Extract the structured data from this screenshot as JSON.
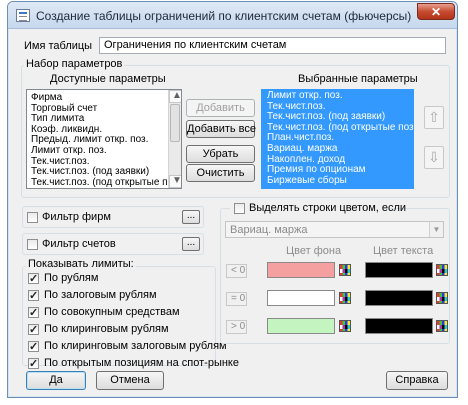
{
  "window": {
    "title": "Создание таблицы ограничений по клиентским счетам (фьючерсы)",
    "close_glyph": "✕"
  },
  "table_name": {
    "label": "Имя таблицы",
    "value": "Ограничения по клиентским счетам"
  },
  "params": {
    "group_label": "Набор параметров",
    "available_header": "Доступные параметры",
    "selected_header": "Выбранные параметры",
    "available": [
      "Фирма",
      "Торговый счет",
      "Тип лимита",
      "Коэф. ликвидн.",
      "Предыд. лимит откр. поз.",
      "Лимит откр. поз.",
      "Тек.чист.поз.",
      "Тек.чист.поз. (под заявки)",
      "Тек.чист.поз. (под открытые по"
    ],
    "selected": [
      "Лимит откр. поз.",
      "Тек.чист.поз.",
      "Тек.чист.поз. (под заявки)",
      "Тек.чист.поз. (под открытые поз",
      "План.чист.поз.",
      "Вариац. маржа",
      "Накоплен. доход",
      "Премия по опционам",
      "Биржевые сборы"
    ],
    "buttons": {
      "add": "Добавить",
      "add_all": "Добавить все",
      "remove": "Убрать",
      "clear": "Очистить"
    },
    "move_up_glyph": "⇧",
    "move_down_glyph": "⇩"
  },
  "filters": {
    "firms_label": "Фильтр фирм",
    "accounts_label": "Фильтр счетов",
    "dots": "..."
  },
  "limits": {
    "group_label": "Показывать лимиты:",
    "items": [
      {
        "label": "По рублям",
        "checked": true
      },
      {
        "label": "По залоговым рублям",
        "checked": true
      },
      {
        "label": "По совокупным средствам",
        "checked": true
      },
      {
        "label": "По клиринговым рублям",
        "checked": true
      },
      {
        "label": "По клиринговым залоговым рублям",
        "checked": true
      },
      {
        "label": "По открытым позициям на спот-рынке",
        "checked": true
      }
    ],
    "check_glyph": "✓"
  },
  "highlight": {
    "checkbox_label": "Выделять строки цветом, если",
    "combo_value": "Вариац. маржа",
    "bg_header": "Цвет фона",
    "text_header": "Цвет текста",
    "rows": [
      {
        "cond": "< 0",
        "bg": "#f4a0a0",
        "text": "#000000"
      },
      {
        "cond": "= 0",
        "bg": "#ffffff",
        "text": "#000000"
      },
      {
        "cond": "> 0",
        "bg": "#c4f4c0",
        "text": "#000000"
      }
    ]
  },
  "footer": {
    "ok": "Да",
    "cancel": "Отмена",
    "help": "Справка"
  }
}
